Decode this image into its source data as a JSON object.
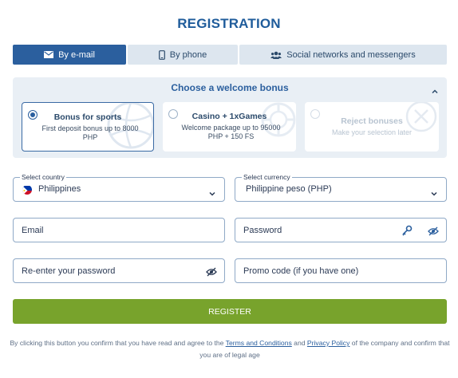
{
  "title": "REGISTRATION",
  "tabs": [
    {
      "label": "By e-mail",
      "icon": "envelope-icon",
      "active": true
    },
    {
      "label": "By phone",
      "icon": "phone-icon",
      "active": false
    },
    {
      "label": "Social networks and messengers",
      "icon": "users-icon",
      "active": false
    }
  ],
  "bonus": {
    "heading": "Choose a welcome bonus",
    "options": [
      {
        "title": "Bonus for sports",
        "description": "First deposit bonus up to 8000 PHP",
        "selected": true
      },
      {
        "title": "Casino + 1xGames",
        "description": "Welcome package up to 95000 PHP + 150 FS",
        "selected": false
      },
      {
        "title": "Reject bonuses",
        "description": "Make your selection later",
        "selected": false
      }
    ]
  },
  "form": {
    "country_label": "Select country",
    "country_value": "Philippines",
    "currency_label": "Select currency",
    "currency_value": "Philippine peso (PHP)",
    "email_placeholder": "Email",
    "password_placeholder": "Password",
    "reenter_placeholder": "Re-enter your password",
    "promo_placeholder": "Promo code (if you have one)"
  },
  "register_label": "REGISTER",
  "legal": {
    "part1": "By clicking this button you confirm that you have read and agree to the ",
    "terms": "Terms and Conditions",
    "and": " and ",
    "privacy": "Privacy Policy",
    "part2": " of the company and confirm that you are of legal age"
  },
  "colors": {
    "accent": "#2b5f9e",
    "title": "#1f5c9b",
    "register": "#78a32c",
    "panel": "#e9eff5"
  }
}
